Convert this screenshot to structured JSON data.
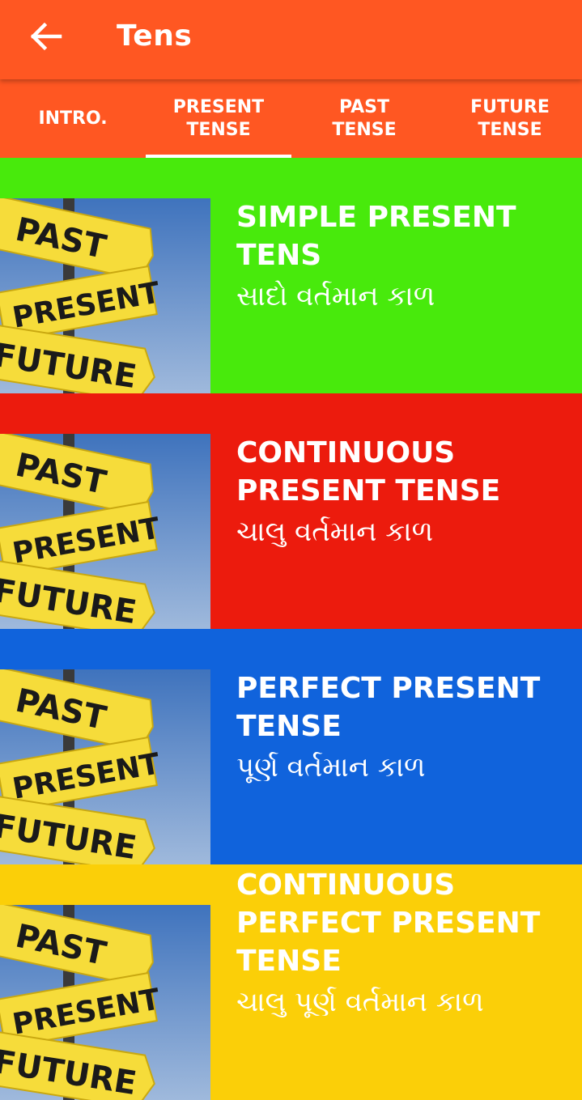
{
  "appbar": {
    "title": "Tens",
    "color": "#ff5722"
  },
  "tabs": [
    {
      "label": "INTRO."
    },
    {
      "label": "PRESENT\nTENSE",
      "selected": true
    },
    {
      "label": "PAST\nTENSE"
    },
    {
      "label": "FUTURE\nTENSE"
    }
  ],
  "thumb": {
    "past": "PAST",
    "present": "PRESENT",
    "future": "FUTURE"
  },
  "items": [
    {
      "title": "SIMPLE PRESENT TENS",
      "subtitle": "સાદો વર્તમાન કાળ",
      "color": "#48ea0c"
    },
    {
      "title": "CONTINUOUS PRESENT TENSE",
      "subtitle": "ચાલુ વર્તમાન કાળ",
      "color": "#ec1b0d"
    },
    {
      "title": "PERFECT PRESENT TENSE",
      "subtitle": "પૂર્ણ વર્તમાન કાળ",
      "color": "#1063dc"
    },
    {
      "title": "CONTINUOUS PERFECT PRESENT TENSE",
      "subtitle": "ચાલુ પૂર્ણ વર્તમાન કાળ",
      "color": "#fbcf08"
    }
  ]
}
